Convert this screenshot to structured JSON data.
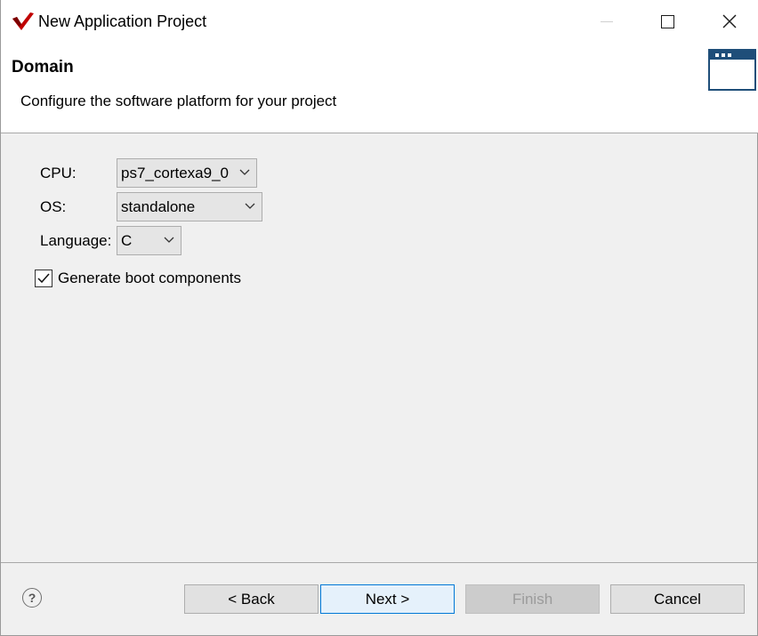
{
  "window": {
    "title": "New Application Project",
    "controls": {
      "minimize": "minimize",
      "maximize": "maximize",
      "close": "close"
    }
  },
  "header": {
    "title": "Domain",
    "description": "Configure the software platform for your project"
  },
  "form": {
    "cpu": {
      "label": "CPU:",
      "value": "ps7_cortexa9_0"
    },
    "os": {
      "label": "OS:",
      "value": "standalone"
    },
    "language": {
      "label": "Language:",
      "value": "C"
    },
    "generate_boot": {
      "label": "Generate boot components",
      "checked": true
    }
  },
  "footer": {
    "help_glyph": "?",
    "back_label": "< Back",
    "next_label": "Next >",
    "finish_label": "Finish",
    "cancel_label": "Cancel"
  },
  "colors": {
    "accent": "#0078d7",
    "header_icon": "#1f4e79",
    "app_icon_red": "#c00000"
  },
  "icons": {
    "app": "xilinx-logo-icon",
    "header": "window-icon",
    "help": "help-icon",
    "dropdown": "chevron-down-icon",
    "check": "checkmark-icon"
  }
}
